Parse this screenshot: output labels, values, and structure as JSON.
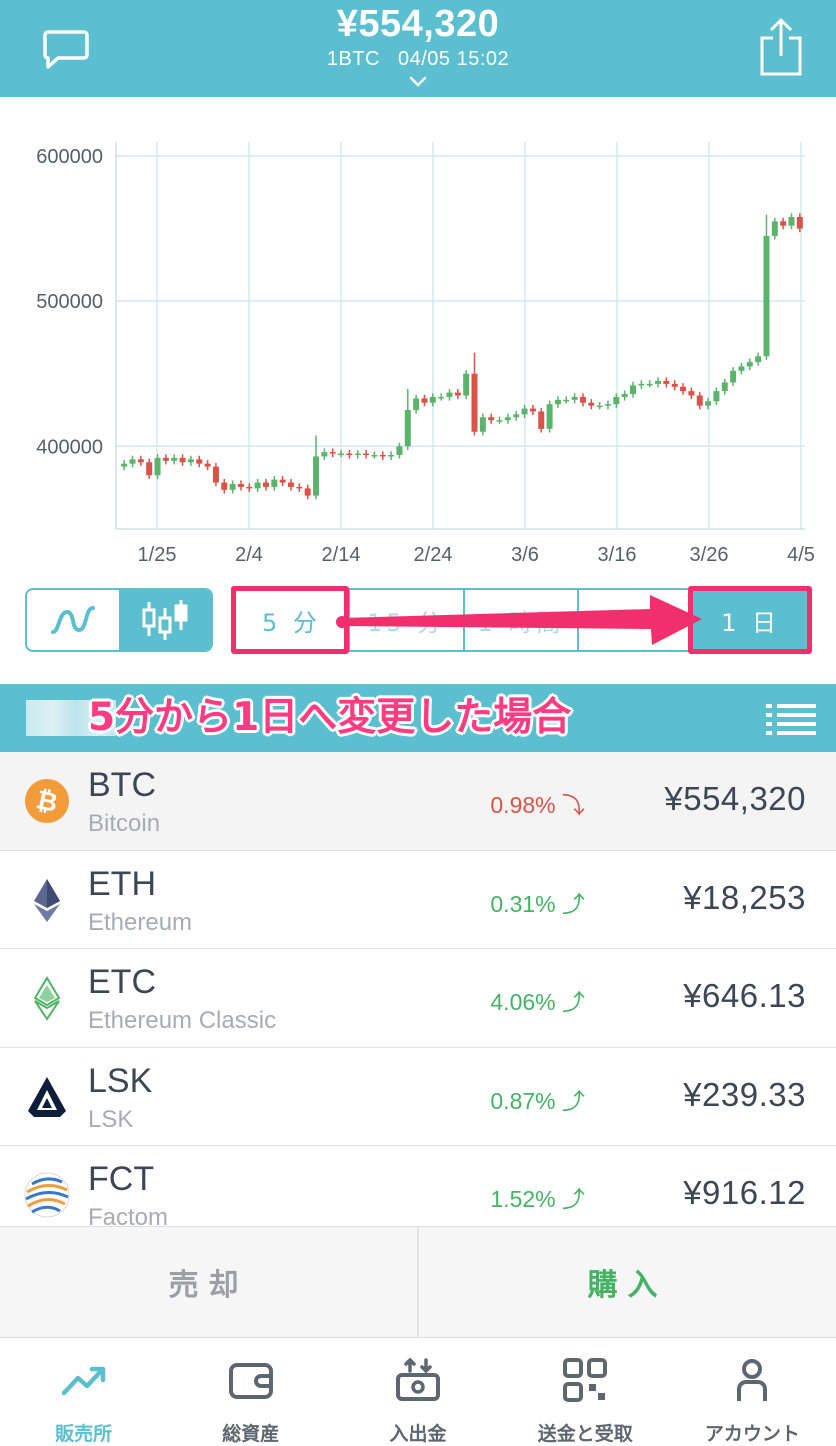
{
  "header": {
    "price": "¥554,320",
    "unit": "1BTC",
    "datetime": "04/05 15:02"
  },
  "chart_data": {
    "type": "candlestick",
    "title": "",
    "xlabel": "",
    "ylabel": "",
    "y_ticks": [
      400000,
      500000,
      600000
    ],
    "ylim": [
      343000,
      620000
    ],
    "x_tick_labels": [
      "1/25",
      "2/4",
      "2/14",
      "2/24",
      "3/6",
      "3/16",
      "3/26",
      "4/5"
    ],
    "x_start": "1/16",
    "x_end": "4/5",
    "grid": true,
    "up_color": "#5cb46c",
    "down_color": "#d9534a",
    "closes": [
      388000,
      391000,
      389000,
      380000,
      392000,
      390000,
      392000,
      389000,
      391000,
      388000,
      386000,
      375000,
      370000,
      374000,
      372000,
      371000,
      375000,
      372000,
      377000,
      375000,
      372000,
      371000,
      366000,
      393000,
      396000,
      395000,
      395000,
      394000,
      395000,
      394000,
      394000,
      393000,
      394000,
      400000,
      425000,
      433000,
      430000,
      434000,
      434000,
      437000,
      435000,
      450000,
      410000,
      420000,
      418000,
      418000,
      420000,
      422000,
      426000,
      424000,
      412000,
      429000,
      432000,
      432000,
      434000,
      430000,
      428000,
      428000,
      429000,
      434000,
      436000,
      442000,
      443000,
      443000,
      445000,
      443000,
      441000,
      438000,
      435000,
      428000,
      431000,
      438000,
      444000,
      452000,
      455000,
      458000,
      462000,
      545000,
      555000,
      552000,
      558000,
      550000
    ]
  },
  "chart_toggle": {
    "line_icon": "line-chart-icon",
    "candle_icon": "candlestick-icon",
    "active": "candle"
  },
  "intervals": [
    {
      "label": "5 分",
      "state": "normal"
    },
    {
      "label": "15 分",
      "state": "faded"
    },
    {
      "label": "1 時間",
      "state": "faded"
    },
    {
      "label": "",
      "state": "normal"
    },
    {
      "label": "1 日",
      "state": "active"
    }
  ],
  "annotation": "5分から1日へ変更した場合",
  "coins": [
    {
      "symbol": "BTC",
      "name": "Bitcoin",
      "change": "0.98%",
      "trend": "down",
      "price": "¥554,320",
      "icon": "bitcoin-icon",
      "color": "#f19b3a"
    },
    {
      "symbol": "ETH",
      "name": "Ethereum",
      "change": "0.31%",
      "trend": "up",
      "price": "¥18,253",
      "icon": "ethereum-icon",
      "color": "#5a6790"
    },
    {
      "symbol": "ETC",
      "name": "Ethereum Classic",
      "change": "4.06%",
      "trend": "up",
      "price": "¥646.13",
      "icon": "ethereum-classic-icon",
      "color": "#4fb464"
    },
    {
      "symbol": "LSK",
      "name": "LSK",
      "change": "0.87%",
      "trend": "up",
      "price": "¥239.33",
      "icon": "lisk-icon",
      "color": "#0d1e3a"
    },
    {
      "symbol": "FCT",
      "name": "Factom",
      "change": "1.52%",
      "trend": "up",
      "price": "¥916.12",
      "icon": "factom-icon",
      "color": "#f19b3a"
    }
  ],
  "actions": {
    "sell": "売却",
    "buy": "購入"
  },
  "tabs": [
    {
      "label": "販売所",
      "icon": "trend-up-icon",
      "active": true
    },
    {
      "label": "総資産",
      "icon": "wallet-icon",
      "active": false
    },
    {
      "label": "入出金",
      "icon": "deposit-withdraw-icon",
      "active": false
    },
    {
      "label": "送金と受取",
      "icon": "qr-code-icon",
      "active": false
    },
    {
      "label": "アカウント",
      "icon": "account-icon",
      "active": false
    }
  ],
  "colors": {
    "accent": "#5bbfcf",
    "highlight": "#f12f6d",
    "up": "#46b265",
    "down": "#d9534a"
  }
}
